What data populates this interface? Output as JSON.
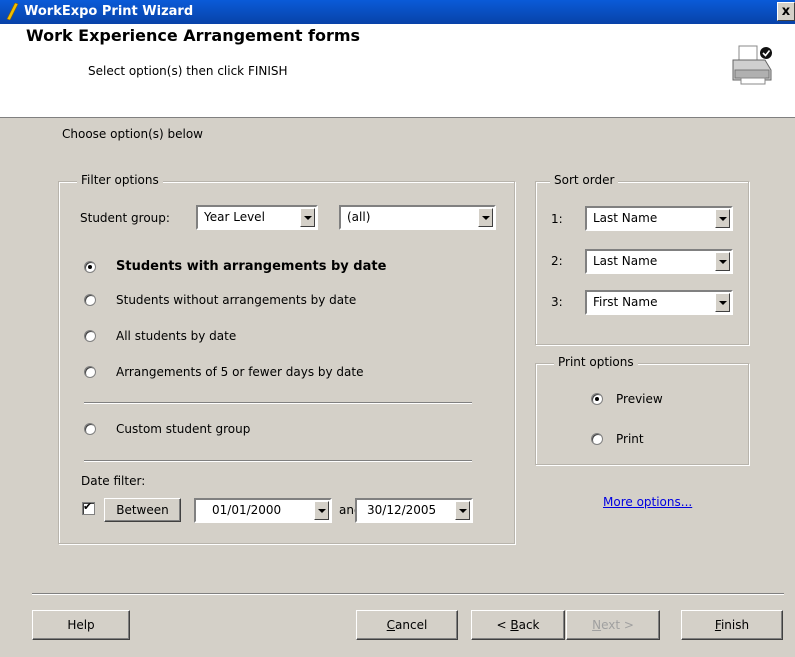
{
  "window": {
    "title": "WorkExpo Print Wizard",
    "close_label": "x"
  },
  "header": {
    "title": "Work Experience Arrangement forms",
    "subtitle": "Select option(s) then click FINISH"
  },
  "main": {
    "instruction": "Choose option(s) below"
  },
  "filter": {
    "legend": "Filter options",
    "student_group_label": "Student group:",
    "group_type": "Year Level",
    "group_value": "(all)",
    "options": [
      "Students with arrangements by date",
      "Students without arrangements by date",
      "All students by date",
      "Arrangements of 5 or fewer days by date",
      "Custom student group"
    ],
    "selected_option": 0,
    "date_filter_label": "Date filter:",
    "date_filter_checked": true,
    "between_label": "Between",
    "date_from": "01/01/2000",
    "and_label": "and",
    "date_to": "30/12/2005"
  },
  "sort": {
    "legend": "Sort order",
    "rows": [
      {
        "num": "1:",
        "value": "Last Name"
      },
      {
        "num": "2:",
        "value": "Last Name"
      },
      {
        "num": "3:",
        "value": "First Name"
      }
    ]
  },
  "print": {
    "legend": "Print options",
    "preview_label": "Preview",
    "print_label": "Print",
    "selected": "Preview"
  },
  "more_options": "More options...",
  "buttons": {
    "help": "Help",
    "cancel_pre": "",
    "cancel_key": "C",
    "cancel_post": "ancel",
    "back_pre": "< ",
    "back_key": "B",
    "back_post": "ack",
    "next_pre": "",
    "next_key": "N",
    "next_post": "ext >",
    "finish_pre": "",
    "finish_key": "F",
    "finish_post": "inish"
  }
}
